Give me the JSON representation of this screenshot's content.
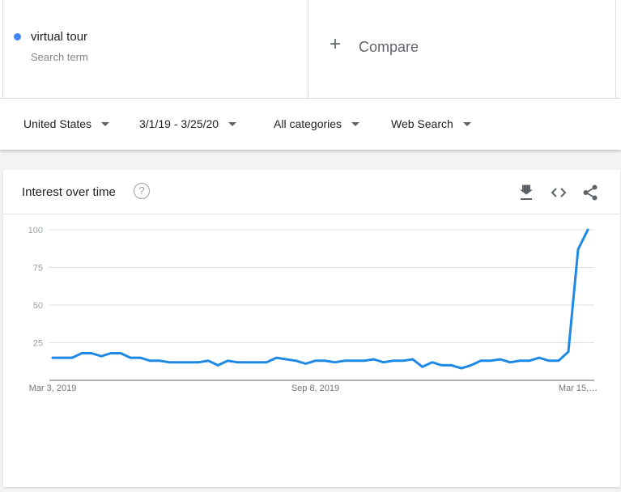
{
  "search": {
    "term": "virtual tour",
    "term_label": "Search term",
    "term_color": "#4285f4",
    "compare_label": "Compare"
  },
  "filters": {
    "region": "United States",
    "date_range": "3/1/19 - 3/25/20",
    "category": "All categories",
    "search_type": "Web Search"
  },
  "panel": {
    "title": "Interest over time",
    "help_glyph": "?"
  },
  "icons": [
    "download-icon",
    "embed-icon",
    "share-icon"
  ],
  "chart_data": {
    "type": "line",
    "title": "",
    "xlabel": "",
    "ylabel": "",
    "ylim": [
      0,
      100
    ],
    "yticks": [
      25,
      50,
      75,
      100
    ],
    "grid": true,
    "line_color": "#1e88e5",
    "x_tick_labels": [
      {
        "label": "Mar 3, 2019",
        "index": 0
      },
      {
        "label": "Sep 8, 2019",
        "index": 27
      },
      {
        "label": "Mar 15,…",
        "index": 54
      }
    ],
    "series": [
      {
        "values": [
          15,
          15,
          15,
          18,
          18,
          16,
          18,
          18,
          15,
          15,
          13,
          13,
          12,
          12,
          12,
          12,
          13,
          10,
          13,
          12,
          12,
          12,
          12,
          15,
          14,
          13,
          11,
          13,
          13,
          12,
          13,
          13,
          13,
          14,
          12,
          13,
          13,
          14,
          9,
          12,
          10,
          10,
          8,
          10,
          13,
          13,
          14,
          12,
          13,
          13,
          15,
          13,
          13,
          19,
          87,
          100
        ]
      }
    ]
  }
}
